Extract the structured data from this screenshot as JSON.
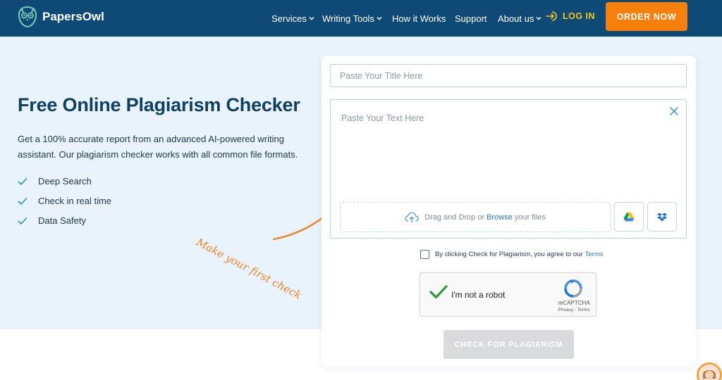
{
  "header": {
    "brand": "PapersOwl",
    "nav": [
      {
        "label": "Services",
        "dropdown": true
      },
      {
        "label": "Writing Tools",
        "dropdown": true
      },
      {
        "label": "How it Works",
        "dropdown": false
      },
      {
        "label": "Support",
        "dropdown": false
      },
      {
        "label": "About us",
        "dropdown": true
      }
    ],
    "login_label": "LOG IN",
    "order_label": "ORDER NOW"
  },
  "hero": {
    "title": "Free Online Plagiarism Checker",
    "description": "Get a 100% accurate report from an advanced AI-powered writing assistant. Our plagiarism checker works with all common file formats.",
    "features": [
      "Deep Search",
      "Check in real time",
      "Data Safety"
    ],
    "hint": "Make your first check"
  },
  "form": {
    "title_placeholder": "Paste Your Title Here",
    "text_placeholder": "Paste Your Text Here",
    "drop_prefix": "Drag and Drop or",
    "browse_label": "Browse",
    "drop_suffix": "your files",
    "agree_text": "By clicking Check for Plagiarism, you agree to our",
    "terms_label": "Terms",
    "captcha": {
      "label": "I'm not a robot",
      "brand": "reCAPTCHA",
      "links": "Privacy - Terms"
    },
    "submit_label": "CHECK FOR PLAGIARISM"
  },
  "colors": {
    "header_bg": "#0f4a76",
    "order_bg": "#f77f0c",
    "login": "#f5c518",
    "hero_bg": "#e8f3fc",
    "hint": "#f08428",
    "link": "#2a76b8",
    "submit_disabled": "#d8dadc"
  },
  "icons": [
    "owl-logo-icon",
    "login-arrow-icon",
    "check-icon",
    "close-icon",
    "upload-cloud-icon",
    "google-drive-icon",
    "dropbox-icon",
    "recaptcha-icon",
    "curved-arrow-icon"
  ]
}
